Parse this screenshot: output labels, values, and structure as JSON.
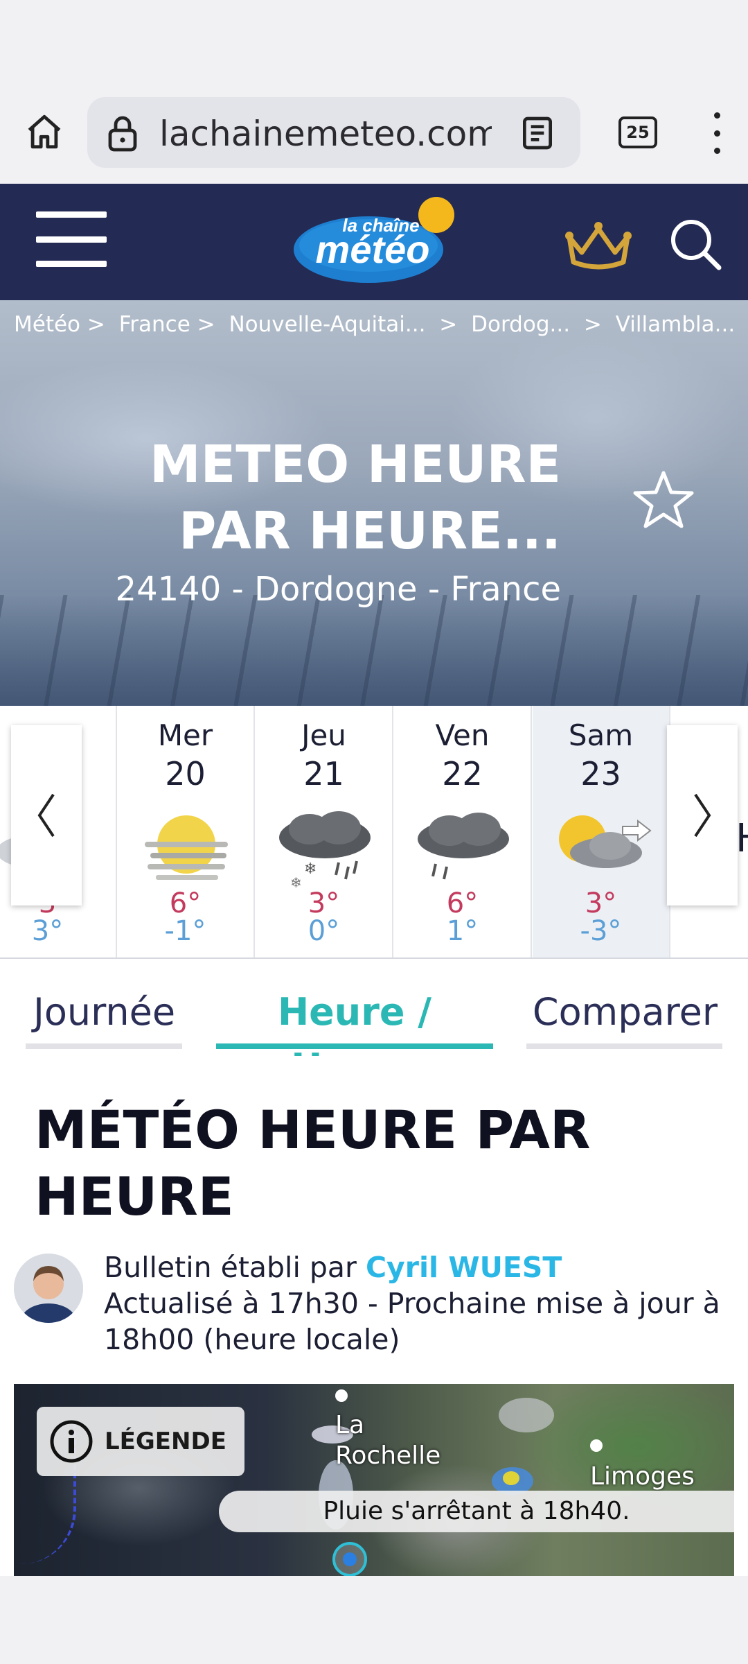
{
  "browser": {
    "url": "lachainemeteo.com/",
    "tab_count": "25"
  },
  "header": {
    "logo_top": "la chaîne",
    "logo_main": "météo"
  },
  "breadcrumb": [
    "Météo >",
    "France >",
    "Nouvelle-Aquitai...",
    ">",
    "Dordog...",
    ">",
    "Villambla..."
  ],
  "hero": {
    "title_line1": "METEO HEURE",
    "title_line2": "PAR HEURE...",
    "subtitle": "24140 - Dordogne - France"
  },
  "days": [
    {
      "name": "",
      "num": "",
      "max": "3",
      "min": "3°",
      "icon": "cloudy-sun-icon",
      "partial": true
    },
    {
      "name": "Mer",
      "num": "20",
      "max": "6°",
      "min": "-1°",
      "icon": "hazy-sun-icon"
    },
    {
      "name": "Jeu",
      "num": "21",
      "max": "3°",
      "min": "0°",
      "icon": "snow-rain-icon"
    },
    {
      "name": "Ven",
      "num": "22",
      "max": "6°",
      "min": "1°",
      "icon": "rain-cloud-icon"
    },
    {
      "name": "Sam",
      "num": "23",
      "max": "3°",
      "min": "-3°",
      "icon": "sun-cloud-wind-icon"
    }
  ],
  "right_edge_letter": "H",
  "tabs": [
    {
      "label": "Journée",
      "active": false
    },
    {
      "label": "Heure / Heure",
      "active": true
    },
    {
      "label": "Comparer",
      "active": false
    }
  ],
  "section": {
    "title_line1": "MÉTÉO HEURE PAR",
    "title_line2": "HEURE"
  },
  "bulletin": {
    "prefix": "Bulletin établi par",
    "author": "Cyril WUEST",
    "update_line1": "Actualisé à 17h30 - Prochaine mise à jour à",
    "update_line2": "18h00 (heure locale)"
  },
  "map": {
    "legend_label": "LÉGENDE",
    "city1_line1": "La",
    "city1_line2": "Rochelle",
    "city2": "Limoges",
    "rain_note": "Pluie s'arrêtant à 18h40."
  },
  "colors": {
    "header_bg": "#232a54",
    "accent_teal": "#2bb8b4",
    "temp_max": "#c33a5d",
    "temp_min": "#5b9fd6",
    "author_link": "#2ab7e6"
  }
}
